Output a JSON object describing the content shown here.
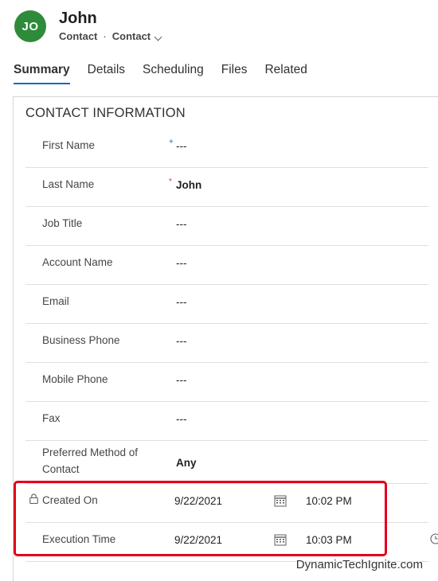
{
  "record": {
    "initials": "JO",
    "name": "John",
    "entity": "Contact",
    "separator": "·",
    "form": "Contact"
  },
  "colors": {
    "avatar": "#2e8b3a",
    "tab_underline": "#0f6cbd",
    "required_asterisk": "#d13438",
    "recommended_plus": "#0f6cbd",
    "highlight_box": "#e3001b"
  },
  "tabs": [
    {
      "label": "Summary",
      "active": true
    },
    {
      "label": "Details",
      "active": false
    },
    {
      "label": "Scheduling",
      "active": false
    },
    {
      "label": "Files",
      "active": false
    },
    {
      "label": "Related",
      "active": false
    }
  ],
  "section": {
    "title": "CONTACT INFORMATION",
    "fields": [
      {
        "label": "First Name",
        "marker": "+",
        "value": "---"
      },
      {
        "label": "Last Name",
        "marker": "*",
        "value": "John"
      },
      {
        "label": "Job Title",
        "value": "---"
      },
      {
        "label": "Account Name",
        "value": "---"
      },
      {
        "label": "Email",
        "value": "---"
      },
      {
        "label": "Business Phone",
        "value": "---"
      },
      {
        "label": "Mobile Phone",
        "value": "---"
      },
      {
        "label": "Fax",
        "value": "---"
      },
      {
        "label_line1": "Preferred Method of",
        "label_line2": "Contact",
        "value": "Any"
      },
      {
        "label": "Created On",
        "date": "9/22/2021",
        "time": "10:02 PM",
        "icon": "lock-icon"
      },
      {
        "label": "Execution Time",
        "date": "9/22/2021",
        "time": "10:03 PM",
        "icon": "clock-icon"
      }
    ]
  },
  "watermark": "DynamicTechIgnite.com"
}
